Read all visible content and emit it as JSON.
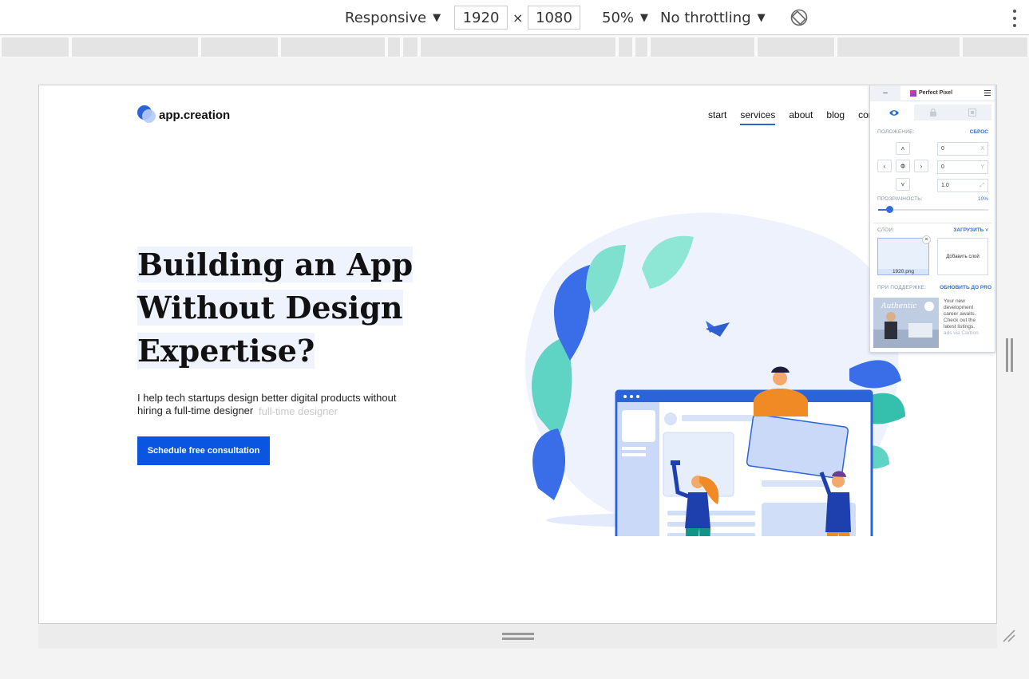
{
  "devtools": {
    "device_mode": "Responsive",
    "width": "1920",
    "height": "1080",
    "times": "×",
    "zoom": "50%",
    "throttling": "No throttling",
    "dropdown_glyph": "▼"
  },
  "site": {
    "logo_text": "app.creation",
    "nav": [
      "start",
      "services",
      "about",
      "blog",
      "con"
    ],
    "active_nav": "services",
    "headline": [
      "Building an App",
      "Without Design",
      "Expertise?"
    ],
    "subline_1": "I help tech startups design better digital products without",
    "subline_2": "hiring a full-time designer",
    "ghost_text": "full-time designer",
    "cta_label": "Schedule free consultation",
    "colors": {
      "accent": "#0a56e0",
      "logo_blue": "#2b63d9"
    }
  },
  "perfect_pixel": {
    "minimize": "–",
    "title": "Perfect Pixel",
    "position_label": "ПОЛОЖЕНИЕ:",
    "reset_label": "СБРОС",
    "center_glyph": "Ф",
    "x_value": "0",
    "x_axis": "X",
    "y_value": "0",
    "y_axis": "Y",
    "scale_value": "1.0",
    "opacity_label": "ПРОЗРАЧНОСТЬ:",
    "opacity_value": "10%",
    "opacity_fraction": 0.1,
    "layers_label": "СЛОИ:",
    "upload_label": "ЗАГРУЗИТЬ",
    "layer_name": "1920.png",
    "layer_close": "×",
    "add_layer": "Добавить слой",
    "support_label": "ПРИ ПОДДЕРЖКЕ:",
    "upgrade_label": "ОБНОВИТЬ ДО PRO",
    "ad_lines": [
      "Your new",
      "development",
      "career awaits.",
      "Check out the",
      "latest listings."
    ],
    "ad_via": "ads via Carbon",
    "ad_brand": "Authentic"
  }
}
